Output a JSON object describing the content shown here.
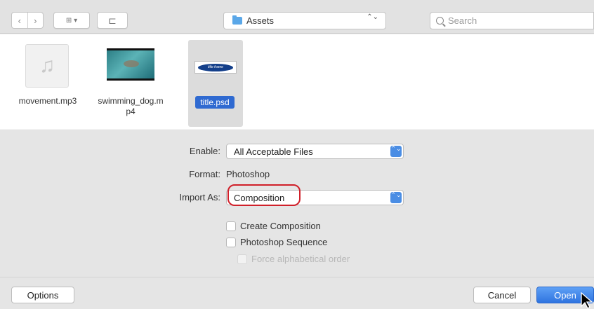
{
  "toolbar": {
    "back_icon": "‹",
    "forward_icon": "›",
    "view_icon": "⊞ ▾",
    "new_folder_icon": "⊏",
    "location": "Assets",
    "location_arrows": "⌃⌄",
    "search_placeholder": "Search"
  },
  "files": [
    {
      "name": "movement.mp3",
      "kind": "audio",
      "icon": "music-note-icon",
      "glyph": "♫"
    },
    {
      "name": "swimming_dog.m\np4",
      "kind": "video"
    },
    {
      "name": "title.psd",
      "kind": "image",
      "selected": true,
      "thumb_text": "title frame"
    }
  ],
  "options": {
    "enable_label": "Enable:",
    "enable_value": "All Acceptable Files",
    "format_label": "Format:",
    "format_value": "Photoshop",
    "import_label": "Import As:",
    "import_value": "Composition",
    "popup_arrows": "⌃⌄",
    "checkboxes": [
      {
        "label": "Create Composition",
        "checked": false,
        "enabled": true
      },
      {
        "label": "Photoshop Sequence",
        "checked": false,
        "enabled": true
      },
      {
        "label": "Force alphabetical order",
        "checked": false,
        "enabled": false
      }
    ]
  },
  "footer": {
    "options_label": "Options",
    "cancel_label": "Cancel",
    "open_label": "Open"
  },
  "colors": {
    "accent": "#2f6ad1",
    "highlight_ring": "#d0202a"
  }
}
